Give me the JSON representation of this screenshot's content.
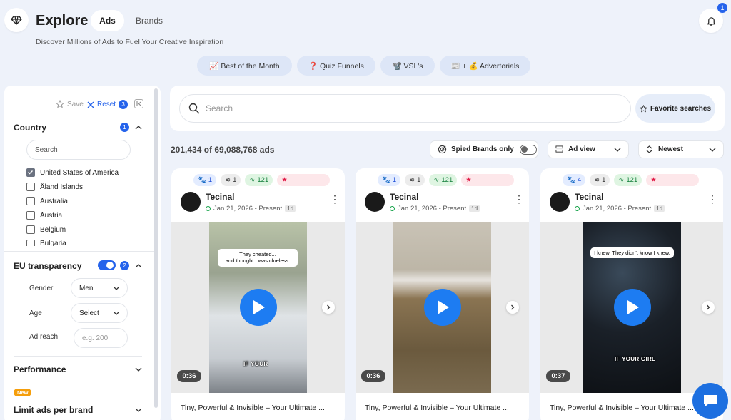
{
  "header": {
    "title": "Explore",
    "tabs": [
      {
        "label": "Ads",
        "active": true
      },
      {
        "label": "Brands",
        "active": false
      }
    ],
    "subtitle": "Discover Millions of Ads to Fuel Your Creative Inspiration",
    "notification_count": "1"
  },
  "quick_filters": [
    "📈 Best of the Month",
    "❓ Quiz Funnels",
    "📽️ VSL's",
    "📰 + 💰 Advertorials"
  ],
  "sidebar": {
    "save_label": "Save",
    "reset_label": "Reset",
    "reset_count": "3",
    "country": {
      "title": "Country",
      "count": "1",
      "search_placeholder": "Search",
      "items": [
        {
          "label": "United States of America",
          "checked": true
        },
        {
          "label": "Åland Islands",
          "checked": false
        },
        {
          "label": "Australia",
          "checked": false
        },
        {
          "label": "Austria",
          "checked": false
        },
        {
          "label": "Belgium",
          "checked": false
        },
        {
          "label": "Bulgaria",
          "checked": false
        }
      ]
    },
    "eu": {
      "title": "EU transparency",
      "count": "2",
      "gender_label": "Gender",
      "gender_value": "Men",
      "age_label": "Age",
      "age_value": "Select",
      "reach_label": "Ad reach",
      "reach_placeholder": "e.g. 200"
    },
    "performance_title": "Performance",
    "new_badge": "New",
    "limit_title": "Limit ads per brand"
  },
  "search": {
    "placeholder": "Search",
    "favorites_label": "Favorite searches"
  },
  "results": {
    "count_text": "201,434 of 69,088,768 ads",
    "spied_label": "Spied Brands only",
    "view_label": "Ad view",
    "sort_label": "Newest"
  },
  "cards": [
    {
      "chips": [
        "1",
        "1",
        "121"
      ],
      "brand": "Tecinal",
      "date": "Jan 21, 2026 - Present",
      "age": "1d",
      "duration": "0:36",
      "bubble": "They cheated...\nand thought I was clueless.",
      "overlay": "IF YOUR",
      "description": "Tiny, Powerful & Invisible – Your Ultimate ..."
    },
    {
      "chips": [
        "1",
        "1",
        "121"
      ],
      "brand": "Tecinal",
      "date": "Jan 21, 2026 - Present",
      "age": "1d",
      "duration": "0:36",
      "bubble": "",
      "overlay": "",
      "description": "Tiny, Powerful & Invisible – Your Ultimate ..."
    },
    {
      "chips": [
        "4",
        "1",
        "121"
      ],
      "brand": "Tecinal",
      "date": "Jan 21, 2026 - Present",
      "age": "1d",
      "duration": "0:37",
      "bubble": "I knew. They didn't know I knew.",
      "overlay": "IF YOUR GIRL",
      "description": "Tiny, Powerful & Invisible – Your Ultimate ..."
    }
  ]
}
